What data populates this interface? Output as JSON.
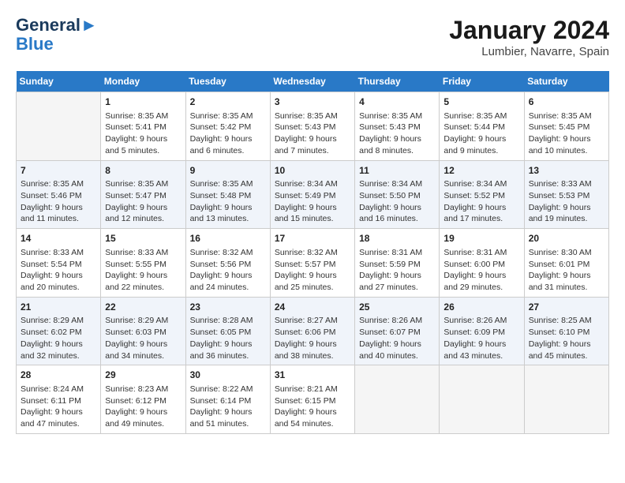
{
  "header": {
    "logo_line1": "General",
    "logo_line2": "Blue",
    "month_title": "January 2024",
    "location": "Lumbier, Navarre, Spain"
  },
  "days_of_week": [
    "Sunday",
    "Monday",
    "Tuesday",
    "Wednesday",
    "Thursday",
    "Friday",
    "Saturday"
  ],
  "weeks": [
    [
      {
        "day": "",
        "empty": true
      },
      {
        "day": "1",
        "sunrise": "Sunrise: 8:35 AM",
        "sunset": "Sunset: 5:41 PM",
        "daylight": "Daylight: 9 hours and 5 minutes."
      },
      {
        "day": "2",
        "sunrise": "Sunrise: 8:35 AM",
        "sunset": "Sunset: 5:42 PM",
        "daylight": "Daylight: 9 hours and 6 minutes."
      },
      {
        "day": "3",
        "sunrise": "Sunrise: 8:35 AM",
        "sunset": "Sunset: 5:43 PM",
        "daylight": "Daylight: 9 hours and 7 minutes."
      },
      {
        "day": "4",
        "sunrise": "Sunrise: 8:35 AM",
        "sunset": "Sunset: 5:43 PM",
        "daylight": "Daylight: 9 hours and 8 minutes."
      },
      {
        "day": "5",
        "sunrise": "Sunrise: 8:35 AM",
        "sunset": "Sunset: 5:44 PM",
        "daylight": "Daylight: 9 hours and 9 minutes."
      },
      {
        "day": "6",
        "sunrise": "Sunrise: 8:35 AM",
        "sunset": "Sunset: 5:45 PM",
        "daylight": "Daylight: 9 hours and 10 minutes."
      }
    ],
    [
      {
        "day": "7",
        "sunrise": "Sunrise: 8:35 AM",
        "sunset": "Sunset: 5:46 PM",
        "daylight": "Daylight: 9 hours and 11 minutes."
      },
      {
        "day": "8",
        "sunrise": "Sunrise: 8:35 AM",
        "sunset": "Sunset: 5:47 PM",
        "daylight": "Daylight: 9 hours and 12 minutes."
      },
      {
        "day": "9",
        "sunrise": "Sunrise: 8:35 AM",
        "sunset": "Sunset: 5:48 PM",
        "daylight": "Daylight: 9 hours and 13 minutes."
      },
      {
        "day": "10",
        "sunrise": "Sunrise: 8:34 AM",
        "sunset": "Sunset: 5:49 PM",
        "daylight": "Daylight: 9 hours and 15 minutes."
      },
      {
        "day": "11",
        "sunrise": "Sunrise: 8:34 AM",
        "sunset": "Sunset: 5:50 PM",
        "daylight": "Daylight: 9 hours and 16 minutes."
      },
      {
        "day": "12",
        "sunrise": "Sunrise: 8:34 AM",
        "sunset": "Sunset: 5:52 PM",
        "daylight": "Daylight: 9 hours and 17 minutes."
      },
      {
        "day": "13",
        "sunrise": "Sunrise: 8:33 AM",
        "sunset": "Sunset: 5:53 PM",
        "daylight": "Daylight: 9 hours and 19 minutes."
      }
    ],
    [
      {
        "day": "14",
        "sunrise": "Sunrise: 8:33 AM",
        "sunset": "Sunset: 5:54 PM",
        "daylight": "Daylight: 9 hours and 20 minutes."
      },
      {
        "day": "15",
        "sunrise": "Sunrise: 8:33 AM",
        "sunset": "Sunset: 5:55 PM",
        "daylight": "Daylight: 9 hours and 22 minutes."
      },
      {
        "day": "16",
        "sunrise": "Sunrise: 8:32 AM",
        "sunset": "Sunset: 5:56 PM",
        "daylight": "Daylight: 9 hours and 24 minutes."
      },
      {
        "day": "17",
        "sunrise": "Sunrise: 8:32 AM",
        "sunset": "Sunset: 5:57 PM",
        "daylight": "Daylight: 9 hours and 25 minutes."
      },
      {
        "day": "18",
        "sunrise": "Sunrise: 8:31 AM",
        "sunset": "Sunset: 5:59 PM",
        "daylight": "Daylight: 9 hours and 27 minutes."
      },
      {
        "day": "19",
        "sunrise": "Sunrise: 8:31 AM",
        "sunset": "Sunset: 6:00 PM",
        "daylight": "Daylight: 9 hours and 29 minutes."
      },
      {
        "day": "20",
        "sunrise": "Sunrise: 8:30 AM",
        "sunset": "Sunset: 6:01 PM",
        "daylight": "Daylight: 9 hours and 31 minutes."
      }
    ],
    [
      {
        "day": "21",
        "sunrise": "Sunrise: 8:29 AM",
        "sunset": "Sunset: 6:02 PM",
        "daylight": "Daylight: 9 hours and 32 minutes."
      },
      {
        "day": "22",
        "sunrise": "Sunrise: 8:29 AM",
        "sunset": "Sunset: 6:03 PM",
        "daylight": "Daylight: 9 hours and 34 minutes."
      },
      {
        "day": "23",
        "sunrise": "Sunrise: 8:28 AM",
        "sunset": "Sunset: 6:05 PM",
        "daylight": "Daylight: 9 hours and 36 minutes."
      },
      {
        "day": "24",
        "sunrise": "Sunrise: 8:27 AM",
        "sunset": "Sunset: 6:06 PM",
        "daylight": "Daylight: 9 hours and 38 minutes."
      },
      {
        "day": "25",
        "sunrise": "Sunrise: 8:26 AM",
        "sunset": "Sunset: 6:07 PM",
        "daylight": "Daylight: 9 hours and 40 minutes."
      },
      {
        "day": "26",
        "sunrise": "Sunrise: 8:26 AM",
        "sunset": "Sunset: 6:09 PM",
        "daylight": "Daylight: 9 hours and 43 minutes."
      },
      {
        "day": "27",
        "sunrise": "Sunrise: 8:25 AM",
        "sunset": "Sunset: 6:10 PM",
        "daylight": "Daylight: 9 hours and 45 minutes."
      }
    ],
    [
      {
        "day": "28",
        "sunrise": "Sunrise: 8:24 AM",
        "sunset": "Sunset: 6:11 PM",
        "daylight": "Daylight: 9 hours and 47 minutes."
      },
      {
        "day": "29",
        "sunrise": "Sunrise: 8:23 AM",
        "sunset": "Sunset: 6:12 PM",
        "daylight": "Daylight: 9 hours and 49 minutes."
      },
      {
        "day": "30",
        "sunrise": "Sunrise: 8:22 AM",
        "sunset": "Sunset: 6:14 PM",
        "daylight": "Daylight: 9 hours and 51 minutes."
      },
      {
        "day": "31",
        "sunrise": "Sunrise: 8:21 AM",
        "sunset": "Sunset: 6:15 PM",
        "daylight": "Daylight: 9 hours and 54 minutes."
      },
      {
        "day": "",
        "empty": true
      },
      {
        "day": "",
        "empty": true
      },
      {
        "day": "",
        "empty": true
      }
    ]
  ]
}
